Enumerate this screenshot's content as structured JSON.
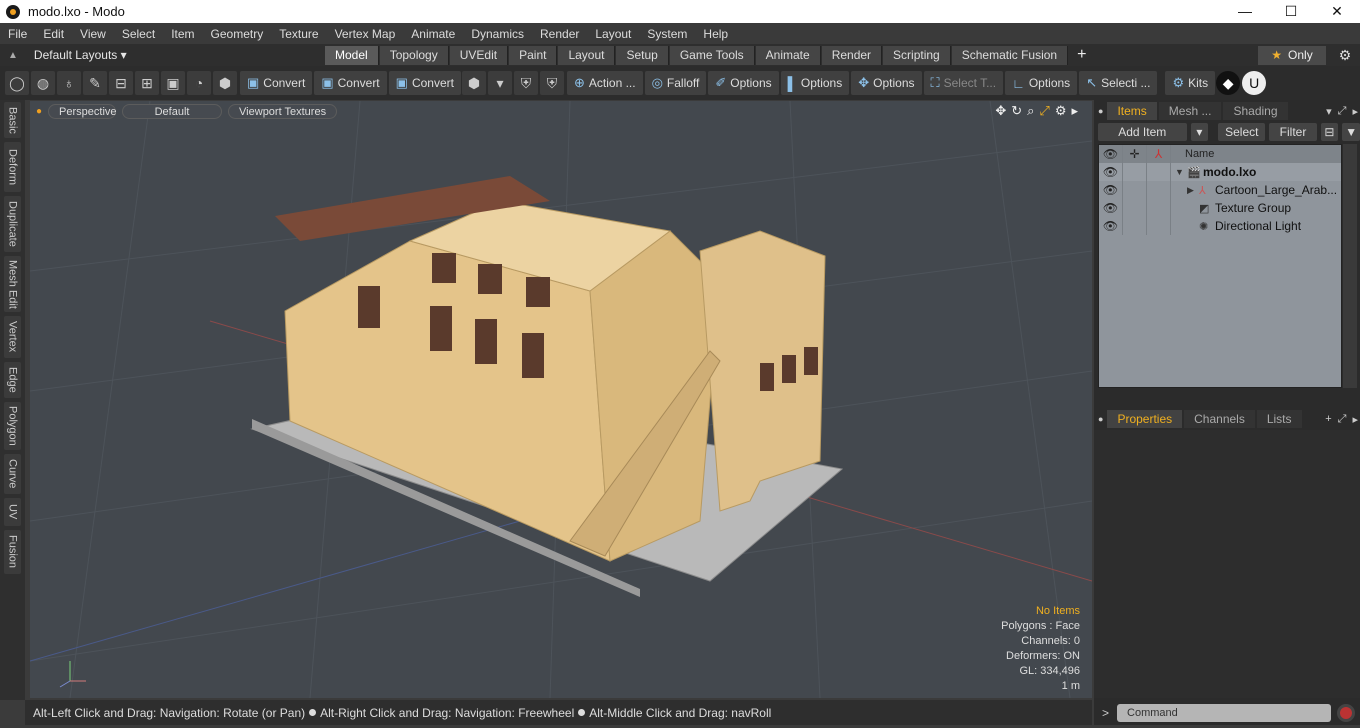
{
  "window": {
    "title": "modo.lxo - Modo",
    "buttons": [
      "—",
      "☐",
      "✕"
    ]
  },
  "menu": [
    "File",
    "Edit",
    "View",
    "Select",
    "Item",
    "Geometry",
    "Texture",
    "Vertex Map",
    "Animate",
    "Dynamics",
    "Render",
    "Layout",
    "System",
    "Help"
  ],
  "layouts": {
    "label": "Default Layouts ▾"
  },
  "tabs": [
    "Model",
    "Topology",
    "UVEdit",
    "Paint",
    "Layout",
    "Setup",
    "Game Tools",
    "Animate",
    "Render",
    "Scripting",
    "Schematic Fusion"
  ],
  "active_tab": "Model",
  "only": {
    "label": "Only"
  },
  "toolbar": {
    "convert1": "Convert",
    "convert2": "Convert",
    "convert3": "Convert",
    "action": "Action ...",
    "falloff": "Falloff",
    "options1": "Options",
    "options2": "Options",
    "options3": "Options",
    "select_t": "Select T...",
    "options4": "Options",
    "selecti": "Selecti ...",
    "kits": "Kits"
  },
  "left_tabs": [
    "Basic",
    "Deform",
    "Duplicate",
    "Mesh Edit",
    "Vertex",
    "Edge",
    "Polygon",
    "Curve",
    "UV",
    "Fusion"
  ],
  "viewport": {
    "perspective": "Perspective",
    "default": "Default",
    "textures": "Viewport Textures",
    "stats": {
      "no_items": "No Items",
      "polygons": "Polygons : Face",
      "channels": "Channels: 0",
      "deformers": "Deformers: ON",
      "gl": "GL: 334,496",
      "scale": "1 m"
    }
  },
  "status": {
    "hint1": "Alt-Left Click and Drag: Navigation: Rotate (or Pan)",
    "hint2": "Alt-Right Click and Drag: Navigation: Freewheel",
    "hint3": "Alt-Middle Click and Drag: navRoll"
  },
  "items_panel": {
    "tabs": [
      "Items",
      "Mesh ...",
      "Shading"
    ],
    "add_item": "Add Item",
    "select": "Select",
    "filter": "Filter",
    "name_header": "Name",
    "rows": [
      {
        "name": "modo.lxo"
      },
      {
        "name": "Cartoon_Large_Arab..."
      },
      {
        "name": "Texture Group"
      },
      {
        "name": "Directional Light"
      }
    ]
  },
  "props_panel": {
    "tabs": [
      "Properties",
      "Channels",
      "Lists"
    ]
  },
  "command": {
    "placeholder": "Command"
  }
}
